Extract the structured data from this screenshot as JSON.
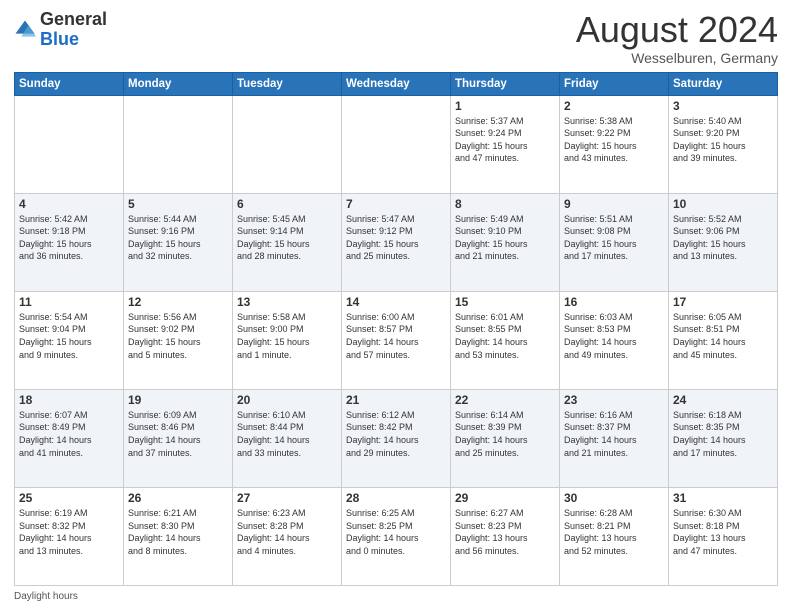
{
  "header": {
    "logo": {
      "general": "General",
      "blue": "Blue"
    },
    "title": "August 2024",
    "location": "Wesselburen, Germany"
  },
  "days_of_week": [
    "Sunday",
    "Monday",
    "Tuesday",
    "Wednesday",
    "Thursday",
    "Friday",
    "Saturday"
  ],
  "weeks": [
    [
      {
        "num": "",
        "info": ""
      },
      {
        "num": "",
        "info": ""
      },
      {
        "num": "",
        "info": ""
      },
      {
        "num": "",
        "info": ""
      },
      {
        "num": "1",
        "info": "Sunrise: 5:37 AM\nSunset: 9:24 PM\nDaylight: 15 hours\nand 47 minutes."
      },
      {
        "num": "2",
        "info": "Sunrise: 5:38 AM\nSunset: 9:22 PM\nDaylight: 15 hours\nand 43 minutes."
      },
      {
        "num": "3",
        "info": "Sunrise: 5:40 AM\nSunset: 9:20 PM\nDaylight: 15 hours\nand 39 minutes."
      }
    ],
    [
      {
        "num": "4",
        "info": "Sunrise: 5:42 AM\nSunset: 9:18 PM\nDaylight: 15 hours\nand 36 minutes."
      },
      {
        "num": "5",
        "info": "Sunrise: 5:44 AM\nSunset: 9:16 PM\nDaylight: 15 hours\nand 32 minutes."
      },
      {
        "num": "6",
        "info": "Sunrise: 5:45 AM\nSunset: 9:14 PM\nDaylight: 15 hours\nand 28 minutes."
      },
      {
        "num": "7",
        "info": "Sunrise: 5:47 AM\nSunset: 9:12 PM\nDaylight: 15 hours\nand 25 minutes."
      },
      {
        "num": "8",
        "info": "Sunrise: 5:49 AM\nSunset: 9:10 PM\nDaylight: 15 hours\nand 21 minutes."
      },
      {
        "num": "9",
        "info": "Sunrise: 5:51 AM\nSunset: 9:08 PM\nDaylight: 15 hours\nand 17 minutes."
      },
      {
        "num": "10",
        "info": "Sunrise: 5:52 AM\nSunset: 9:06 PM\nDaylight: 15 hours\nand 13 minutes."
      }
    ],
    [
      {
        "num": "11",
        "info": "Sunrise: 5:54 AM\nSunset: 9:04 PM\nDaylight: 15 hours\nand 9 minutes."
      },
      {
        "num": "12",
        "info": "Sunrise: 5:56 AM\nSunset: 9:02 PM\nDaylight: 15 hours\nand 5 minutes."
      },
      {
        "num": "13",
        "info": "Sunrise: 5:58 AM\nSunset: 9:00 PM\nDaylight: 15 hours\nand 1 minute."
      },
      {
        "num": "14",
        "info": "Sunrise: 6:00 AM\nSunset: 8:57 PM\nDaylight: 14 hours\nand 57 minutes."
      },
      {
        "num": "15",
        "info": "Sunrise: 6:01 AM\nSunset: 8:55 PM\nDaylight: 14 hours\nand 53 minutes."
      },
      {
        "num": "16",
        "info": "Sunrise: 6:03 AM\nSunset: 8:53 PM\nDaylight: 14 hours\nand 49 minutes."
      },
      {
        "num": "17",
        "info": "Sunrise: 6:05 AM\nSunset: 8:51 PM\nDaylight: 14 hours\nand 45 minutes."
      }
    ],
    [
      {
        "num": "18",
        "info": "Sunrise: 6:07 AM\nSunset: 8:49 PM\nDaylight: 14 hours\nand 41 minutes."
      },
      {
        "num": "19",
        "info": "Sunrise: 6:09 AM\nSunset: 8:46 PM\nDaylight: 14 hours\nand 37 minutes."
      },
      {
        "num": "20",
        "info": "Sunrise: 6:10 AM\nSunset: 8:44 PM\nDaylight: 14 hours\nand 33 minutes."
      },
      {
        "num": "21",
        "info": "Sunrise: 6:12 AM\nSunset: 8:42 PM\nDaylight: 14 hours\nand 29 minutes."
      },
      {
        "num": "22",
        "info": "Sunrise: 6:14 AM\nSunset: 8:39 PM\nDaylight: 14 hours\nand 25 minutes."
      },
      {
        "num": "23",
        "info": "Sunrise: 6:16 AM\nSunset: 8:37 PM\nDaylight: 14 hours\nand 21 minutes."
      },
      {
        "num": "24",
        "info": "Sunrise: 6:18 AM\nSunset: 8:35 PM\nDaylight: 14 hours\nand 17 minutes."
      }
    ],
    [
      {
        "num": "25",
        "info": "Sunrise: 6:19 AM\nSunset: 8:32 PM\nDaylight: 14 hours\nand 13 minutes."
      },
      {
        "num": "26",
        "info": "Sunrise: 6:21 AM\nSunset: 8:30 PM\nDaylight: 14 hours\nand 8 minutes."
      },
      {
        "num": "27",
        "info": "Sunrise: 6:23 AM\nSunset: 8:28 PM\nDaylight: 14 hours\nand 4 minutes."
      },
      {
        "num": "28",
        "info": "Sunrise: 6:25 AM\nSunset: 8:25 PM\nDaylight: 14 hours\nand 0 minutes."
      },
      {
        "num": "29",
        "info": "Sunrise: 6:27 AM\nSunset: 8:23 PM\nDaylight: 13 hours\nand 56 minutes."
      },
      {
        "num": "30",
        "info": "Sunrise: 6:28 AM\nSunset: 8:21 PM\nDaylight: 13 hours\nand 52 minutes."
      },
      {
        "num": "31",
        "info": "Sunrise: 6:30 AM\nSunset: 8:18 PM\nDaylight: 13 hours\nand 47 minutes."
      }
    ]
  ],
  "footer": {
    "daylight_label": "Daylight hours"
  }
}
